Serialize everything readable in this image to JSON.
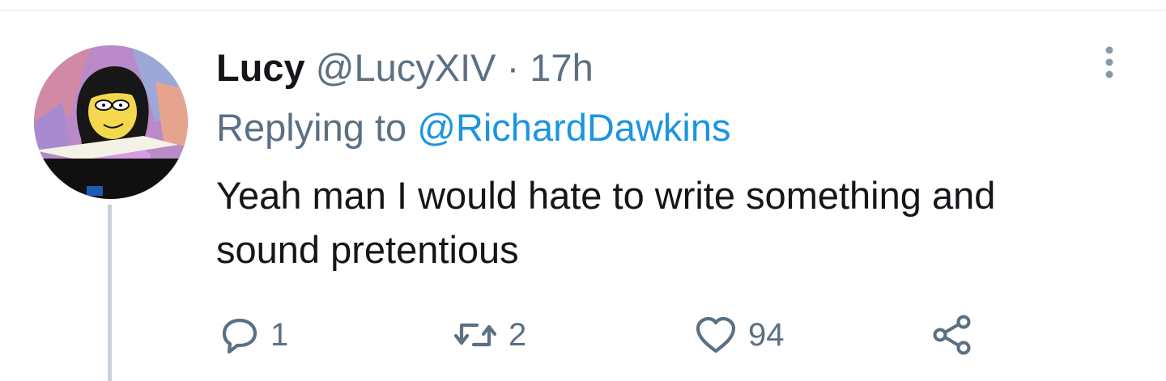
{
  "tweet": {
    "display_name": "Lucy",
    "handle": "@LucyXIV",
    "separator": "·",
    "time": "17h",
    "replying_prefix": "Replying to",
    "replying_to": "@RichardDawkins",
    "text": "Yeah man I would hate to write something and sound pretentious"
  },
  "actions": {
    "reply_icon": "reply-icon",
    "reply_count": "1",
    "retweet_icon": "retweet-icon",
    "retweet_count": "2",
    "like_icon": "heart-icon",
    "like_count": "94",
    "share_icon": "share-icon"
  },
  "menu": {
    "icon": "more-vertical-icon"
  },
  "colors": {
    "text_primary": "#141619",
    "text_secondary": "#5b7083",
    "link": "#1b95e0",
    "thread_line": "#c9d0d6"
  }
}
